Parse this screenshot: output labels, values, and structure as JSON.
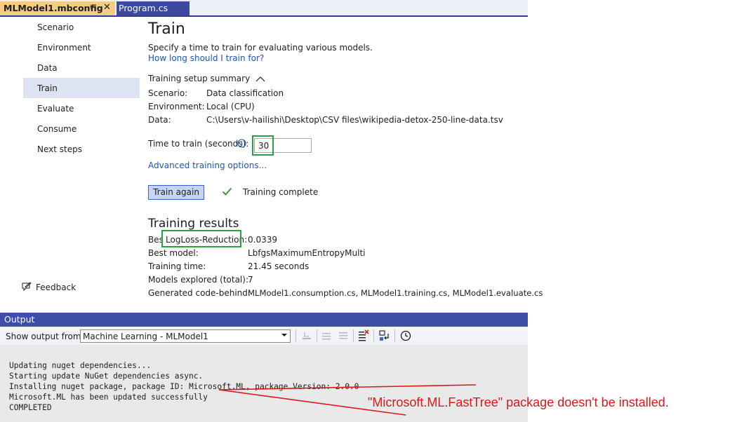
{
  "tabs": [
    {
      "label": "MLModel1.mbconfig",
      "pin_icon": "pin-icon",
      "close_glyph": "✕"
    },
    {
      "label": "Program.cs"
    }
  ],
  "nav": {
    "items": [
      "Scenario",
      "Environment",
      "Data",
      "Train",
      "Evaluate",
      "Consume",
      "Next steps"
    ],
    "selected": "Train",
    "feedback": "Feedback"
  },
  "main": {
    "title": "Train",
    "description": "Specify a time to train for evaluating various models.",
    "how_long_link": "How long should I train for?",
    "summary_title": "Training setup summary",
    "summary": {
      "scenario_label": "Scenario:",
      "scenario_value": "Data classification",
      "environment_label": "Environment:",
      "environment_value": "Local (CPU)",
      "data_label": "Data:",
      "data_value": "C:\\Users\\v-hailishi\\Desktop\\CSV files\\wikipedia-detox-250-line-data.tsv"
    },
    "time_label": "Time to train (seconds):",
    "time_value": "30",
    "advanced_link": "Advanced training options...",
    "train_button": "Train again",
    "status": "Training complete",
    "results_title": "Training results",
    "results": {
      "best_label_prefix": "Bes",
      "best_metric": "LogLoss-Reduction:",
      "best_value": "0.0339",
      "best_model_label": "Best model:",
      "best_model_value": "LbfgsMaximumEntropyMulti",
      "training_time_label": "Training time:",
      "training_time_value": "21.45 seconds",
      "models_label": "Models explored (total):",
      "models_value": "7",
      "codebehind_label": "Generated code-behind:",
      "codebehind_value": "MLModel1.consumption.cs, MLModel1.training.cs, MLModel1.evaluate.cs"
    }
  },
  "output": {
    "title": "Output",
    "show_from_label": "Show output from:",
    "source": "Machine Learning - MLModel1",
    "lines": [
      "Updating nuget dependencies...",
      "Starting update NuGet dependencies async.",
      "Installing nuget package, package ID: Microsoft.ML, package Version: 2.0.0",
      "Microsoft.ML has been updated successfully",
      "COMPLETED"
    ]
  },
  "annotation": "\"Microsoft.ML.FastTree\" package doesn't be installed.",
  "colors": {
    "accent": "#3d4ea8",
    "tab_active": "#f5cc84",
    "highlight_box": "#2aa140",
    "annotation": "#d8191b",
    "link": "#1a55b8"
  }
}
